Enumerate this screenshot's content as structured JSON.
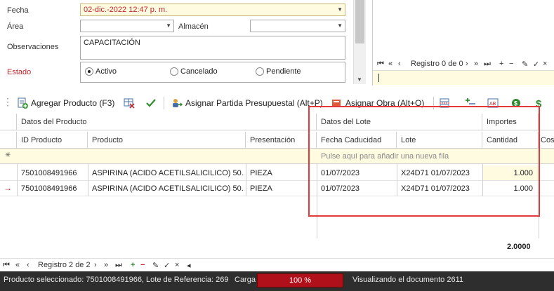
{
  "form": {
    "fecha_label": "Fecha",
    "fecha_value": "02-dic.-2022 12:47 p. m.",
    "area_label": "Área",
    "area_value": "",
    "almacen_label": "Almacén",
    "almacen_value": "",
    "observaciones_label": "Observaciones",
    "observaciones_value": "CAPACITACIÓN",
    "estado_label": "Estado",
    "estado_options": [
      "Activo",
      "Cancelado",
      "Pendiente"
    ],
    "estado_selected": "Activo"
  },
  "right_panel": {
    "record_label": "Registro 0 de 0"
  },
  "toolbar": {
    "add_product": "Agregar Producto (F3)",
    "assign_budget": "Asignar Partida Presupuestal (Alt+P)",
    "assign_work": "Asignar Obra (Alt+O)"
  },
  "grid": {
    "groups": [
      "Datos del Producto",
      "Datos del Lote",
      "Importes"
    ],
    "columns": [
      "ID Producto",
      "Producto",
      "Presentación",
      "Fecha Caducidad",
      "Lote",
      "Cantidad",
      "Cos"
    ],
    "new_row_hint": "Pulse aquí para añadir una nueva fila",
    "rows": [
      {
        "id": "7501008491966",
        "producto": "ASPIRINA (ACIDO ACETILSALICILICO) 50...",
        "presentacion": "PIEZA",
        "caducidad": "01/07/2023",
        "lote": "X24D71 01/07/2023",
        "cantidad": "1.000"
      },
      {
        "id": "7501008491966",
        "producto": "ASPIRINA (ACIDO ACETILSALICILICO) 50...",
        "presentacion": "PIEZA",
        "caducidad": "01/07/2023",
        "lote": "X24D71 01/07/2023",
        "cantidad": "1.000"
      }
    ],
    "total": "2.0000"
  },
  "bottom_nav": {
    "record_label": "Registro 2 de 2"
  },
  "status": {
    "selected_product": "Producto seleccionado: 7501008491966, Lote de Referencia: 269",
    "load_label": "Carga",
    "load_value": "100 %",
    "load_fraction": 1.0,
    "document": "Visualizando el documento 2611"
  },
  "colors": {
    "required_label": "#c0262d",
    "highlight_box": "#e23a3a",
    "new_row_bg": "#fffbe0",
    "progress_fill": "#b0101a",
    "status_bg": "#2e2e2e"
  }
}
